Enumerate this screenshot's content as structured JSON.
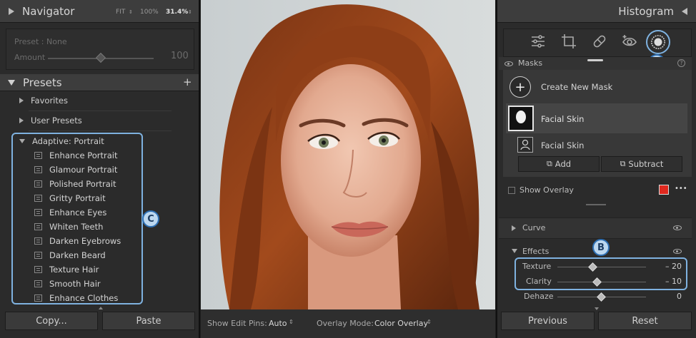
{
  "navigator": {
    "title": "Navigator",
    "zoom_fit": "FIT",
    "zoom_100": "100%",
    "zoom_custom": "31.4%"
  },
  "quick_develop": {
    "preset_label": "Preset : None",
    "amount_label": "Amount",
    "amount_value": "100"
  },
  "presets": {
    "title": "Presets",
    "add_symbol": "+",
    "groups": [
      {
        "label": "Favorites"
      },
      {
        "label": "User Presets"
      },
      {
        "label": "Adaptive: Portrait"
      }
    ],
    "items": [
      "Enhance Portrait",
      "Glamour Portrait",
      "Polished Portrait",
      "Gritty Portrait",
      "Enhance Eyes",
      "Whiten Teeth",
      "Darken Eyebrows",
      "Darken Beard",
      "Texture Hair",
      "Smooth Hair",
      "Enhance Clothes"
    ]
  },
  "left_buttons": {
    "copy": "Copy...",
    "paste": "Paste"
  },
  "toolbar": {
    "edit_pins_label": "Show Edit Pins:",
    "edit_pins_value": "Auto",
    "overlay_mode_label": "Overlay Mode:",
    "overlay_mode_value": "Color Overlay"
  },
  "histogram": {
    "title": "Histogram"
  },
  "masks": {
    "title": "Masks",
    "help": "?",
    "create_new": "Create New Mask",
    "mask_name": "Facial Skin",
    "component_name": "Facial Skin",
    "add": "Add",
    "subtract": "Subtract",
    "show_overlay": "Show Overlay",
    "overlay_color": "#e0291f",
    "more": "•••"
  },
  "sections": {
    "curve": "Curve",
    "effects": "Effects"
  },
  "effects": [
    {
      "label": "Texture",
      "value": "– 20",
      "level": 0.4
    },
    {
      "label": "Clarity",
      "value": "– 10",
      "level": 0.45
    },
    {
      "label": "Dehaze",
      "value": "0",
      "level": 0.5
    }
  ],
  "right_buttons": {
    "previous": "Previous",
    "reset": "Reset"
  },
  "callouts": {
    "a": "A",
    "b": "B",
    "c": "C"
  },
  "colors": {
    "accent_blue": "#7fb2e0",
    "panel_bg": "#2b2b2b"
  }
}
